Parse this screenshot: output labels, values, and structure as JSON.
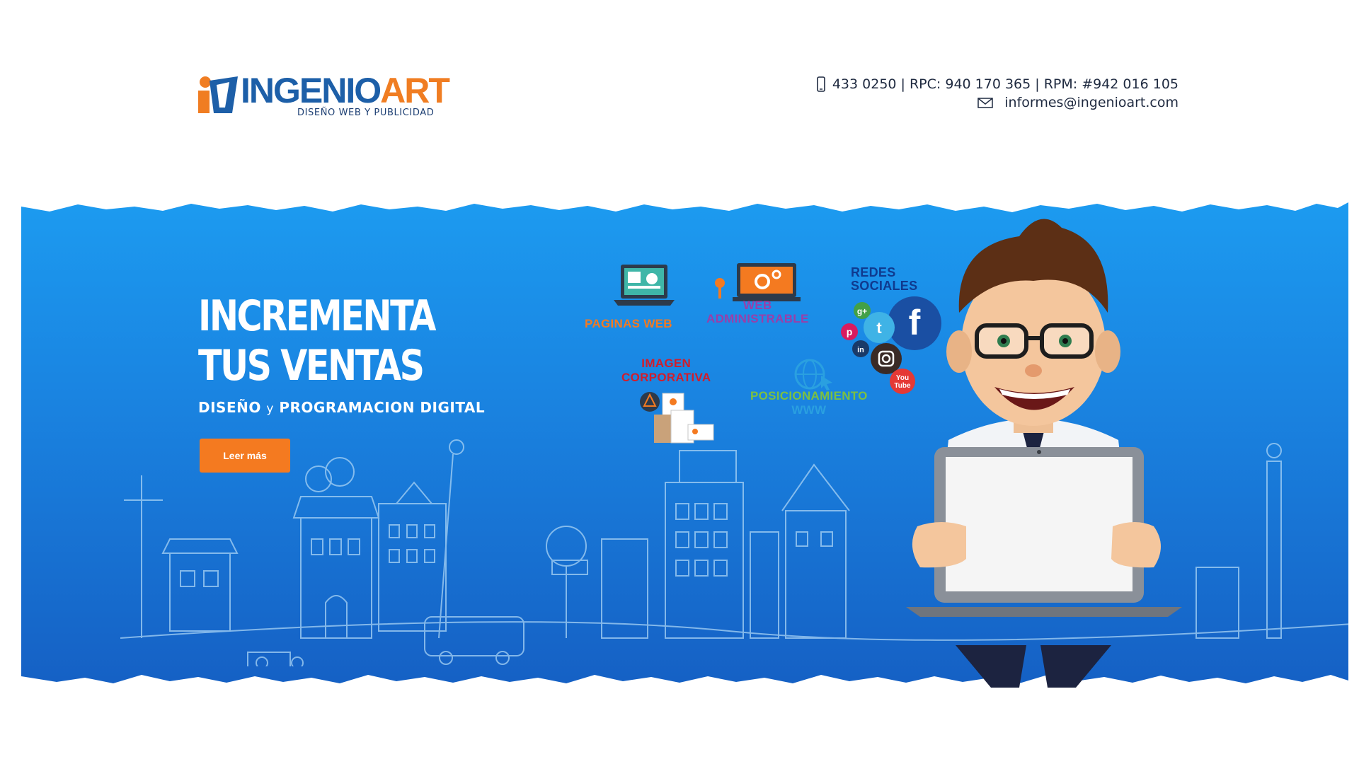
{
  "brand": {
    "name_part1": "INGENIO",
    "name_part2": "ART",
    "tagline": "DISEÑO WEB Y PUBLICIDAD",
    "colors": {
      "blue": "#1d5fa8",
      "orange": "#f07d22"
    }
  },
  "contact": {
    "phone_icon": "phone-icon",
    "phones": "433 0250 | RPC: 940 170 365 | RPM: #942 016 105",
    "email_icon": "envelope-icon",
    "email": "informes@ingenioart.com"
  },
  "hero": {
    "headline_line1": "INCREMENTA",
    "headline_line2": "TUS VENTAS",
    "subline_a": "DISEÑO",
    "subline_b": "y",
    "subline_c": "PROGRAMACION DIGITAL",
    "cta_label": "Leer más",
    "background": "#1a84e1",
    "cta_color": "#f47a20"
  },
  "services": {
    "web_pages": "PAGINAS  WEB",
    "web_admin_1": "WEB",
    "web_admin_2": "ADMINISTRABLE",
    "social_1": "REDES",
    "social_2": "SOCIALES",
    "corporate_1": "IMAGEN",
    "corporate_2": "CORPORATIVA",
    "seo_1": "POSICIONAMIENTO",
    "seo_2": "WWW"
  },
  "social_icons": {
    "google": "g+",
    "twitter": "t",
    "facebook": "f",
    "pinterest": "p",
    "linkedin": "in",
    "youtube_1": "You",
    "youtube_2": "Tube"
  }
}
